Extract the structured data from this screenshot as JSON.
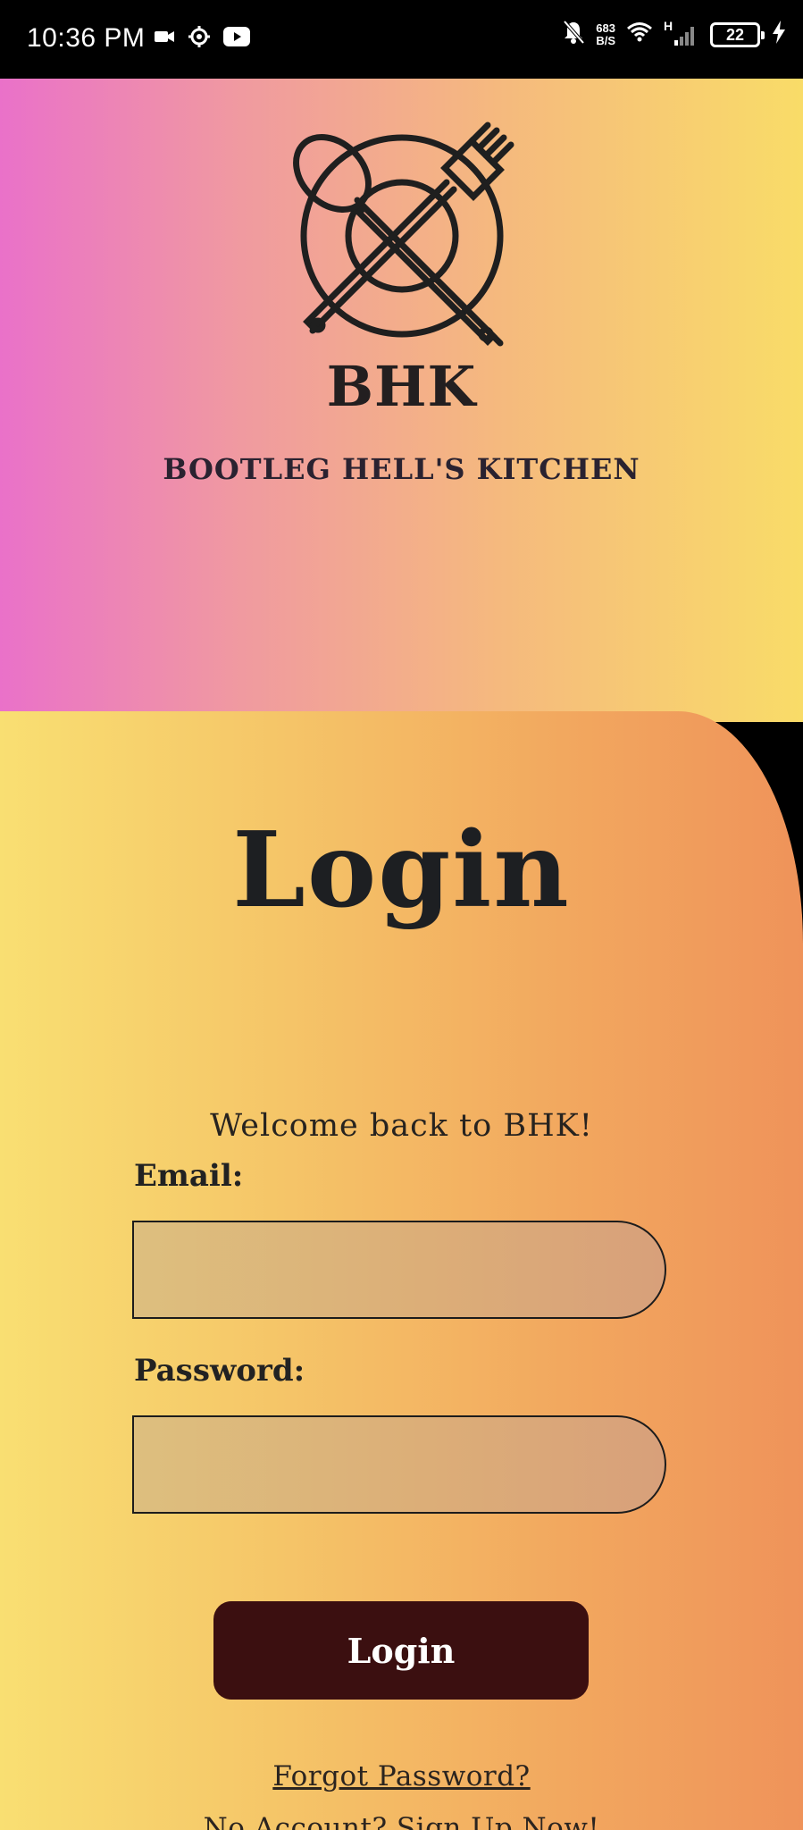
{
  "status_bar": {
    "time": "10:36 PM",
    "net_speed_value": "683",
    "net_speed_unit": "B/S",
    "signal_label": "H",
    "battery_level": "22",
    "icons": [
      "video-camera-icon",
      "settings-gear-icon",
      "youtube-icon",
      "bell-off-icon",
      "wifi-icon",
      "cell-signal-icon",
      "battery-icon",
      "charging-bolt-icon"
    ]
  },
  "header": {
    "logo_icon": "spoon-fork-plate-icon",
    "brand_abbr": "BHK",
    "brand_name": "BOOTLEG HELL'S KITCHEN"
  },
  "login_card": {
    "title": "Login",
    "welcome_text": "Welcome back to BHK!",
    "email_label": "Email:",
    "email_value": "",
    "password_label": "Password:",
    "password_value": "",
    "login_button": "Login",
    "forgot_password_link": "Forgot Password?",
    "signup_link": "No Account? Sign Up Now!"
  },
  "colors": {
    "header_gradient_start": "#ea71c9",
    "header_gradient_end": "#f9dc68",
    "card_gradient_start": "#f9df72",
    "card_gradient_end": "#ef935a",
    "button_bg": "#3b0f10",
    "text_dark": "#1d1f22"
  }
}
